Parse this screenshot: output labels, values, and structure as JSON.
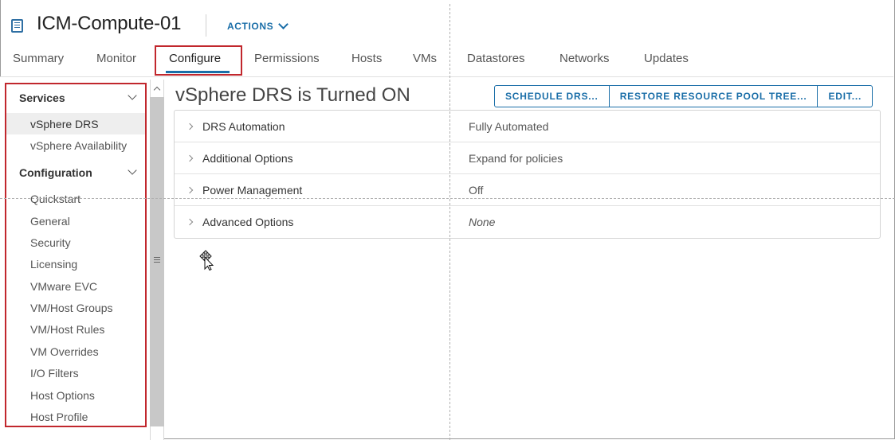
{
  "header": {
    "object_icon": "cluster-icon",
    "title": "ICM-Compute-01",
    "actions_label": "ACTIONS"
  },
  "tabs": [
    {
      "label": "Summary"
    },
    {
      "label": "Monitor"
    },
    {
      "label": "Configure",
      "active": true
    },
    {
      "label": "Permissions"
    },
    {
      "label": "Hosts"
    },
    {
      "label": "VMs"
    },
    {
      "label": "Datastores"
    },
    {
      "label": "Networks"
    },
    {
      "label": "Updates"
    }
  ],
  "sidebar": {
    "sections": [
      {
        "heading": "Services",
        "items": [
          "vSphere DRS",
          "vSphere Availability"
        ]
      },
      {
        "heading": "Configuration",
        "items": [
          "Quickstart",
          "General",
          "Security",
          "Licensing",
          "VMware EVC",
          "VM/Host Groups",
          "VM/Host Rules",
          "VM Overrides",
          "I/O Filters",
          "Host Options",
          "Host Profile"
        ]
      }
    ],
    "selected_item": "vSphere DRS"
  },
  "main": {
    "title": "vSphere DRS is Turned ON",
    "buttons": [
      "SCHEDULE DRS...",
      "RESTORE RESOURCE POOL TREE...",
      "EDIT..."
    ],
    "rows": [
      {
        "label": "DRS Automation",
        "value": "Fully Automated"
      },
      {
        "label": "Additional Options",
        "value": "Expand for policies"
      },
      {
        "label": "Power Management",
        "value": "Off"
      },
      {
        "label": "Advanced Options",
        "value": "None"
      }
    ]
  },
  "colors": {
    "accent": "#1a6ea8",
    "highlight_box": "#c1272d"
  }
}
